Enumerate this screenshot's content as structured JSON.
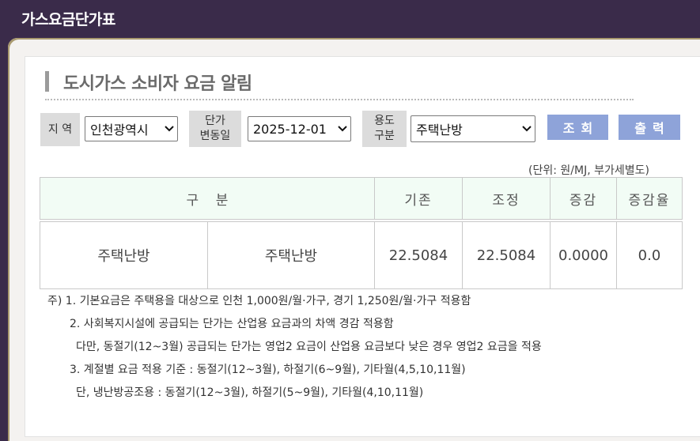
{
  "app": {
    "title": "가스요금단가표"
  },
  "heading": "도시가스 소비자 요금 알림",
  "filters": {
    "region_label": "지 역",
    "region_value": "인천광역시",
    "date_label_line1": "단가",
    "date_label_line2": "변동일",
    "date_value": "2025-12-01",
    "usage_label_line1": "용도",
    "usage_label_line2": "구분",
    "usage_value": "주택난방",
    "search_button": "조회",
    "print_button": "출력"
  },
  "unit_note": "(단위: 원/MJ, 부가세별도)",
  "table": {
    "headers": [
      "구    분",
      "기존",
      "조정",
      "증감",
      "증감율"
    ],
    "row": [
      "주택난방",
      "주택난방",
      "22.5084",
      "22.5084",
      "0.0000",
      "0.0"
    ]
  },
  "notes": [
    "주) 1. 기본요금은 주택용을 대상으로 인천 1,000원/월·가구,  경기 1,250원/월·가구 적용함",
    "2. 사회복지시설에 공급되는 단가는 산업용 요금과의 차액 경감 적용함",
    "다만, 동절기(12~3월) 공급되는 단가는 영업2 요금이 산업용 요금보다 낮은 경우 영업2 요금을 적용",
    "3. 계절별 요금 적용 기준 : 동절기(12~3월), 하절기(6~9월), 기타월(4,5,10,11월)",
    "단, 냉난방공조용 : 동절기(12~3월), 하절기(5~9월), 기타월(4,10,11월)"
  ],
  "colors": {
    "topbar": "#3a2b4a",
    "button": "#8ea3d9",
    "table_header_bg": "#f2fcf5",
    "label_bg": "#dcdcdc"
  },
  "icons": {
    "select_arrow": "chevron-down-icon",
    "heading_marker": "vertical-bar"
  }
}
